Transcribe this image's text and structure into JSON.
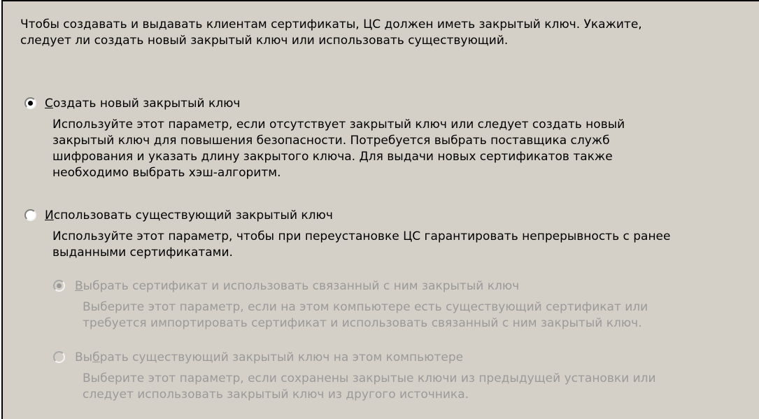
{
  "intro": {
    "line1": "Чтобы создавать и выдавать клиентам сертификаты, ЦС должен иметь закрытый ключ. Укажите,",
    "line2": "следует ли создать новый закрытый ключ или использовать существующий."
  },
  "options": {
    "create_new": {
      "checked": true,
      "enabled": true,
      "label_first": "С",
      "label_rest": "оздать новый закрытый ключ",
      "desc": [
        "Используйте этот параметр, если отсутствует закрытый ключ или следует создать новый",
        "закрытый ключ для повышения безопасности. Потребуется выбрать поставщика служб",
        "шифрования и указать длину закрытого ключа. Для выдачи новых сертификатов также",
        "необходимо выбрать хэш-алгоритм."
      ]
    },
    "use_existing": {
      "checked": false,
      "enabled": true,
      "label_first": "И",
      "label_rest": "спользовать существующий закрытый ключ",
      "desc": [
        "Используйте этот параметр, чтобы при переустановке ЦС гарантировать непрерывность с ранее",
        "выданными сертификатами."
      ]
    },
    "select_certificate": {
      "checked": true,
      "enabled": false,
      "label_first": "В",
      "label_rest": "ыбрать сертификат и использовать связанный с ним закрытый ключ",
      "desc": [
        "Выберите этот параметр, если на этом компьютере есть существующий сертификат или",
        "требуется импортировать сертификат и использовать связанный с ним закрытый ключ."
      ]
    },
    "select_existing_key": {
      "checked": false,
      "enabled": false,
      "label_pre": "Вы",
      "label_first": "б",
      "label_rest": "рать существующий закрытый ключ на этом компьютере",
      "desc": [
        "Выберите этот параметр, если сохранены закрытые ключи из предыдущей установки или",
        "следует использовать закрытый ключ из другого источника."
      ]
    }
  },
  "colors": {
    "panel_bg": "#d4d0c8",
    "text": "#000000",
    "disabled_text": "#9a9a9a"
  }
}
